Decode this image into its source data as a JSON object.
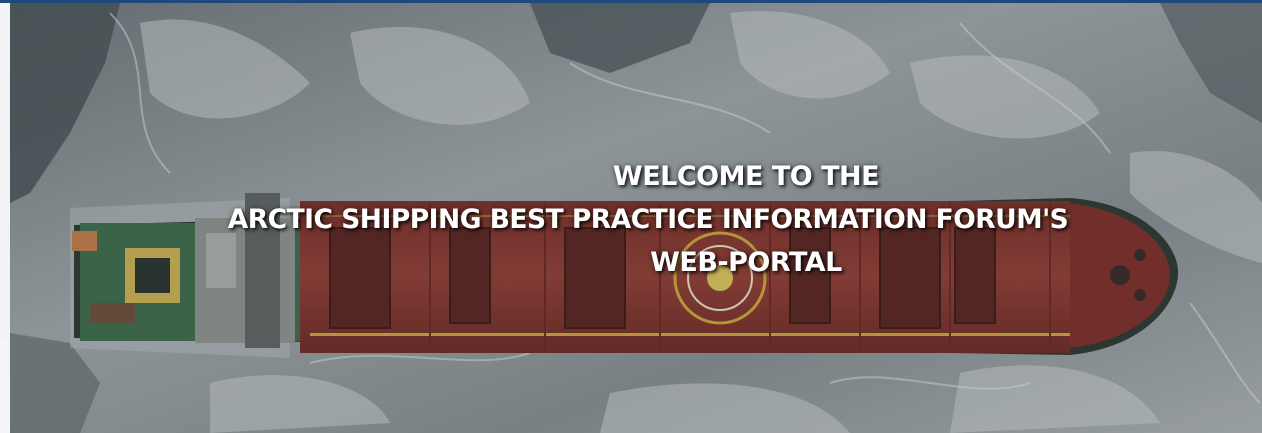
{
  "hero": {
    "image": "aerial view of cargo ship in sea ice",
    "title_line1": "WELCOME TO THE",
    "title_line2": "ARCTIC SHIPPING BEST PRACTICE INFORMATION FORUM'S",
    "title_line3": "WEB-PORTAL"
  },
  "colors": {
    "top_bar": "#1d4a7a",
    "hull": "#8a3a33",
    "deck_green": "#3f6b4c",
    "ice": "#9aa1a4"
  }
}
